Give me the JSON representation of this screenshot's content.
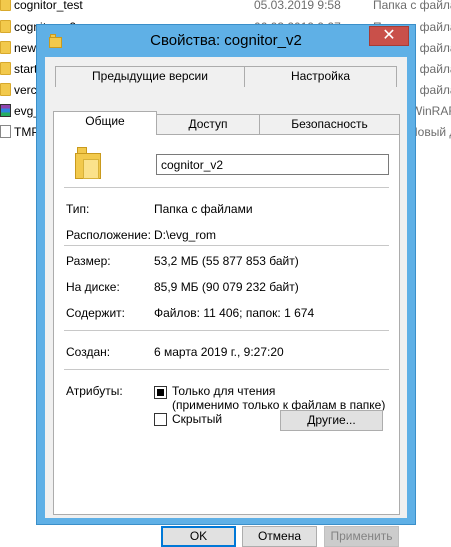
{
  "background_files": [
    {
      "name": "cognitor_test",
      "date": "05.03.2019 9:58",
      "type": "Папка с файлам",
      "icon": "folder-icon"
    },
    {
      "name": "cognitor_v2",
      "date": "06.03.2019 9:27",
      "type": "Папка с файлам",
      "icon": "folder-icon"
    },
    {
      "name": "new",
      "date": "",
      "type": "Папка с файлам",
      "icon": "folder-icon"
    },
    {
      "name": "start",
      "date": "",
      "type": "Папка с файлам",
      "icon": "folder-icon"
    },
    {
      "name": "verc",
      "date": "",
      "type": "Папка с файлам",
      "icon": "folder-icon"
    },
    {
      "name": "evg_",
      "date": "",
      "type": "WinRAR",
      "icon": "winrar-archive-icon"
    },
    {
      "name": "TMP",
      "date": "",
      "type": "Новый до",
      "icon": "text-file-icon"
    }
  ],
  "dialog": {
    "title": "Свойства: cognitor_v2",
    "close_label": "✕",
    "tabs_row1": [
      "Предыдущие версии",
      "Настройка"
    ],
    "tabs_row2": [
      "Общие",
      "Доступ",
      "Безопасность"
    ],
    "active_tab": "Общие",
    "folder_name": "cognitor_v2",
    "props": {
      "type_label": "Тип:",
      "type_value": "Папка с файлами",
      "location_label": "Расположение:",
      "location_value": "D:\\evg_rom",
      "size_label": "Размер:",
      "size_value": "53,2 МБ (55 877 853 байт)",
      "disk_label": "На диске:",
      "disk_value": "85,9 МБ (90 079 232 байт)",
      "contains_label": "Содержит:",
      "contains_value": "Файлов: 11 406; папок: 1 674",
      "created_label": "Создан:",
      "created_value": "6 марта 2019 г., 9:27:20",
      "attributes_label": "Атрибуты:",
      "readonly_label": "Только для чтения",
      "readonly_note": "(применимо только к файлам в папке)",
      "hidden_label": "Скрытый",
      "other_button": "Другие..."
    },
    "buttons": {
      "ok": "OK",
      "cancel": "Отмена",
      "apply": "Применить"
    }
  }
}
